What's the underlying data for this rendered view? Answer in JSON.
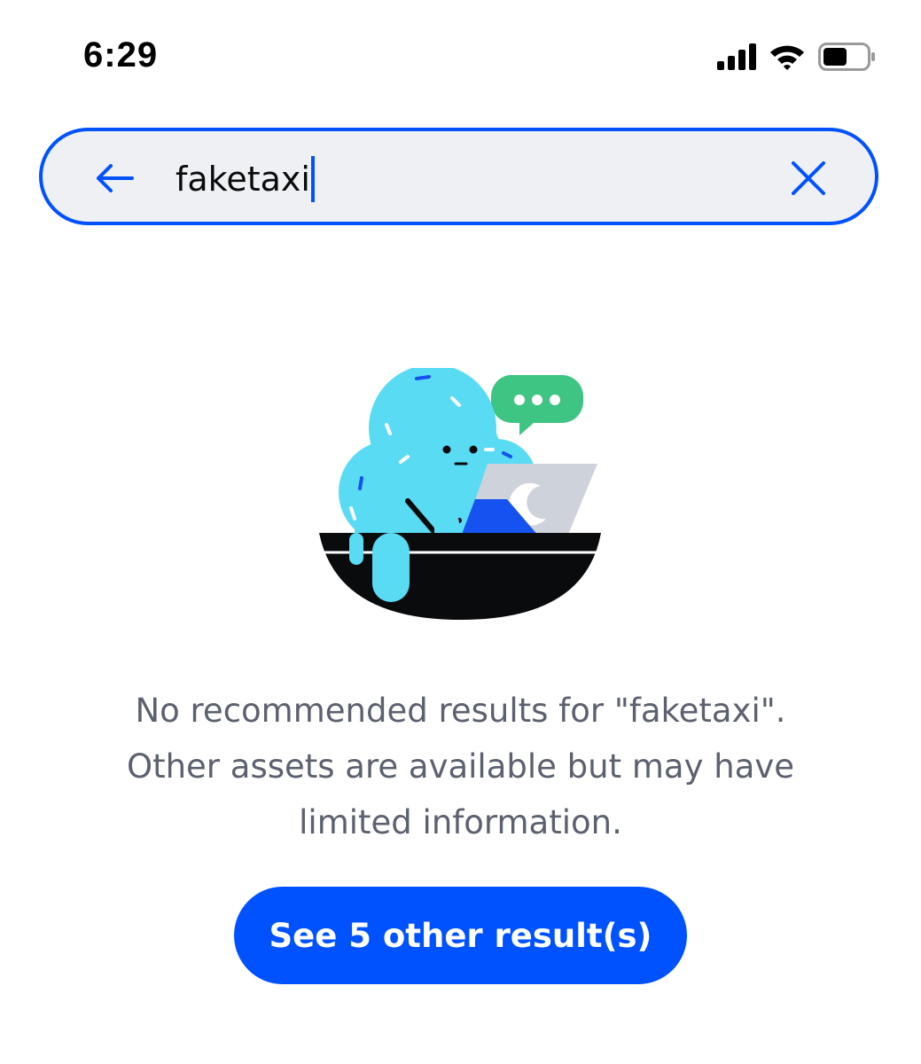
{
  "status_bar": {
    "time": "6:29",
    "icons": [
      "cellular-signal-icon",
      "wifi-icon",
      "battery-icon"
    ]
  },
  "search": {
    "value": "faketaxi",
    "back_icon": "arrow-left-icon",
    "clear_icon": "close-icon",
    "accent_color": "#0052ff",
    "background_color": "#eef0f3"
  },
  "illustration": {
    "icon": "empty-results-illustration"
  },
  "message": {
    "line1": "No recommended results for \"faketaxi\".",
    "line2": "Other assets are available but may have",
    "line3": "limited information."
  },
  "action": {
    "label": "See 5 other result(s)",
    "color": "#0052ff"
  }
}
